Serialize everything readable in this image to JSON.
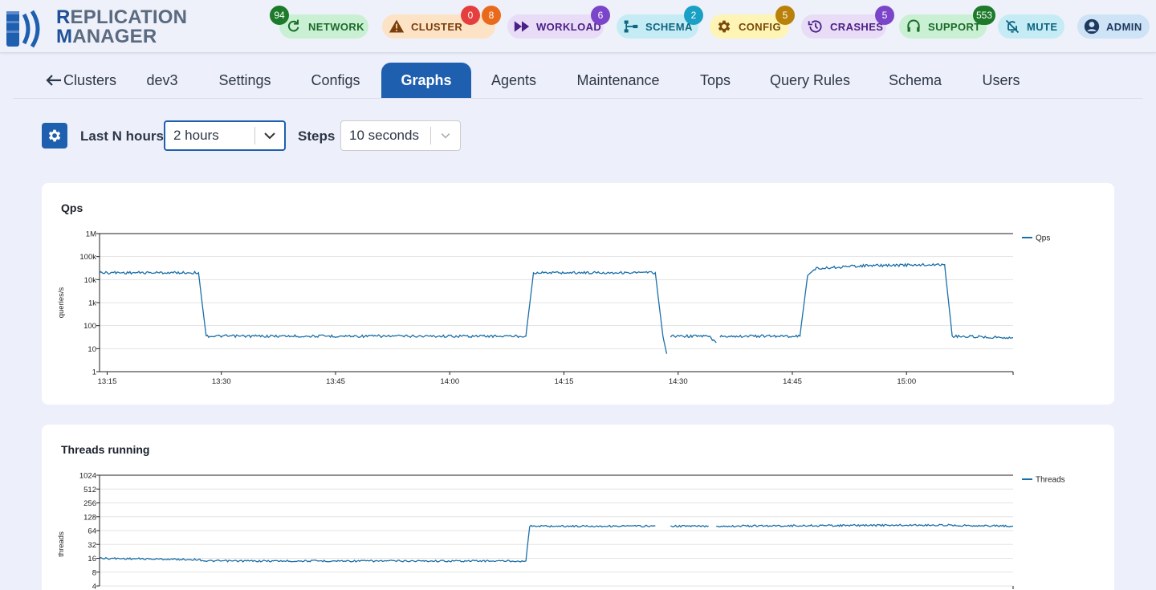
{
  "app": {
    "logo_line1_first": "R",
    "logo_line1_rest": "EPLICATION",
    "logo_line2_first": "M",
    "logo_line2_rest": "ANAGER"
  },
  "header_pills": [
    {
      "label": "NETWORK",
      "icon": "refresh-icon",
      "badges": [
        {
          "text": "94",
          "color": "#1c7a2a"
        }
      ],
      "bg": "#c9f0d3",
      "fg": "#1c6b2a"
    },
    {
      "label": "CLUSTER",
      "icon": "warning-icon",
      "badges": [
        {
          "text": "0",
          "color": "#e53e3e"
        },
        {
          "text": "8",
          "color": "#ea6a1c"
        }
      ],
      "bg": "#fde3c5",
      "fg": "#7a3d0c"
    },
    {
      "label": "WORKLOAD",
      "icon": "fast-forward-icon",
      "badges": [
        {
          "text": "6",
          "color": "#7b45c9"
        }
      ],
      "bg": "#e9dcf7",
      "fg": "#4b2186"
    },
    {
      "label": "SCHEMA",
      "icon": "schema-icon",
      "badges": [
        {
          "text": "2",
          "color": "#1aa0c4"
        }
      ],
      "bg": "#c5ecf5",
      "fg": "#0e6580"
    },
    {
      "label": "CONFIG",
      "icon": "gear-icon",
      "badges": [
        {
          "text": "5",
          "color": "#b9800a"
        }
      ],
      "bg": "#fdf4b5",
      "fg": "#7a4a06"
    },
    {
      "label": "CRASHES",
      "icon": "history-icon",
      "badges": [
        {
          "text": "5",
          "color": "#7b45c9"
        }
      ],
      "bg": "#e9dcf7",
      "fg": "#4b2186"
    },
    {
      "label": "SUPPORT",
      "icon": "headset-icon",
      "badges": [
        {
          "text": "553",
          "color": "#1c7a2a"
        }
      ],
      "bg": "#c9f0d3",
      "fg": "#1c6b2a"
    },
    {
      "label": "MUTE",
      "icon": "bell-off-icon",
      "badges": [],
      "bg": "#c5ecf5",
      "fg": "#0e6580"
    },
    {
      "label": "ADMIN",
      "icon": "user-circle-icon",
      "badges": [],
      "bg": "#cfe3f7",
      "fg": "#1e3a5f"
    }
  ],
  "tabs": [
    {
      "label": "Clusters",
      "icon": "arrow-left-icon",
      "active": false
    },
    {
      "label": "dev3",
      "active": false
    },
    {
      "label": "Settings",
      "active": false
    },
    {
      "label": "Configs",
      "active": false
    },
    {
      "label": "Graphs",
      "active": true
    },
    {
      "label": "Agents",
      "active": false
    },
    {
      "label": "Maintenance",
      "active": false
    },
    {
      "label": "Tops",
      "active": false
    },
    {
      "label": "Query Rules",
      "active": false
    },
    {
      "label": "Schema",
      "active": false
    },
    {
      "label": "Users",
      "active": false
    }
  ],
  "controls": {
    "last_n_hours_label": "Last N hours",
    "last_n_hours_value": "2 hours",
    "steps_label": "Steps",
    "steps_value": "10 seconds"
  },
  "colors": {
    "accent": "#1f5fb0",
    "series": "#1b6fa8"
  },
  "chart_data": [
    {
      "type": "line",
      "title": "Qps",
      "xlabel": "",
      "ylabel": "queries/s",
      "yscale": "log",
      "ylim": [
        1,
        1000000
      ],
      "yticks": [
        "1",
        "10",
        "100",
        "1k",
        "10k",
        "100k",
        "1M"
      ],
      "xticks": [
        "13:15",
        "13:30",
        "13:45",
        "14:00",
        "14:15",
        "14:30",
        "14:45",
        "15:00"
      ],
      "xlim": [
        "13:14",
        "15:14"
      ],
      "legend": "top-right",
      "grid": true,
      "series": [
        {
          "name": "Qps",
          "segments": [
            [
              [
                "13:14",
                20000
              ],
              [
                "13:27",
                20000
              ],
              [
                "13:28",
                35
              ],
              [
                "14:10",
                35
              ],
              [
                "14:11",
                20000
              ],
              [
                "14:27",
                20000
              ],
              [
                "14:28",
                35
              ],
              [
                "14:28:30",
                6
              ]
            ],
            [
              [
                "14:29",
                35
              ],
              [
                "14:34",
                35
              ],
              [
                "14:35",
                18
              ]
            ],
            [
              [
                "14:35:30",
                35
              ],
              [
                "14:46",
                35
              ],
              [
                "14:47",
                15000
              ],
              [
                "14:48",
                30000
              ],
              [
                "14:54",
                40000
              ],
              [
                "15:05",
                45000
              ],
              [
                "15:06",
                35
              ],
              [
                "15:14",
                30
              ]
            ]
          ]
        }
      ]
    },
    {
      "type": "line",
      "title": "Threads running",
      "xlabel": "",
      "ylabel": "threads",
      "yscale": "log2",
      "ylim": [
        4,
        1024
      ],
      "yticks": [
        "4",
        "8",
        "16",
        "32",
        "64",
        "128",
        "256",
        "512",
        "1024"
      ],
      "xlim": [
        "13:14",
        "15:14"
      ],
      "legend": "top-right",
      "grid": true,
      "series": [
        {
          "name": "Threads",
          "segments": [
            [
              [
                "13:14",
                16
              ],
              [
                "13:27",
                15
              ],
              [
                "13:28",
                14
              ],
              [
                "14:10",
                14
              ],
              [
                "14:10:30",
                80
              ],
              [
                "14:27",
                80
              ]
            ],
            [
              [
                "14:29",
                80
              ],
              [
                "14:34",
                80
              ]
            ],
            [
              [
                "14:35",
                80
              ],
              [
                "15:00",
                84
              ],
              [
                "15:05",
                84
              ],
              [
                "15:14",
                80
              ]
            ]
          ]
        }
      ]
    }
  ]
}
